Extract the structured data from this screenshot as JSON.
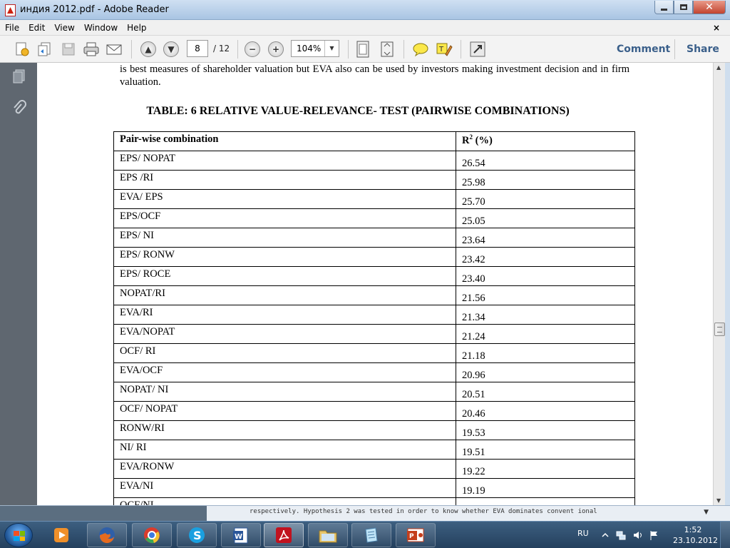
{
  "window": {
    "title": "индия 2012.pdf - Adobe Reader",
    "buttons": {
      "minimize": "minimize-icon",
      "maximize": "maximize-icon",
      "close": "close-icon"
    }
  },
  "menubar": {
    "items": [
      "File",
      "Edit",
      "View",
      "Window",
      "Help"
    ],
    "doc_close": "×"
  },
  "toolbar": {
    "page_current": "8",
    "page_total": "/ 12",
    "zoom": "104%",
    "comment_label": "Comment",
    "share_label": "Share"
  },
  "document": {
    "paragraph": "is best measures of shareholder valuation but EVA also can be used by investors making investment decision and in firm valuation.",
    "table_title": "TABLE: 6 RELATIVE VALUE-RELEVANCE- TEST (PAIRWISE COMBINATIONS)",
    "table_header": {
      "col1": "Pair-wise  combination",
      "col2_base": "R",
      "col2_sup": "2",
      "col2_rest": " (%)"
    },
    "rows": [
      {
        "pair": "EPS/ NOPAT",
        "r2": "26.54"
      },
      {
        "pair": "EPS /RI",
        "r2": "25.98"
      },
      {
        "pair": "EVA/ EPS",
        "r2": "25.70"
      },
      {
        "pair": "EPS/OCF",
        "r2": "25.05"
      },
      {
        "pair": "EPS/ NI",
        "r2": "23.64"
      },
      {
        "pair": "EPS/ RONW",
        "r2": "23.42"
      },
      {
        "pair": "EPS/ ROCE",
        "r2": "23.40"
      },
      {
        "pair": "NOPAT/RI",
        "r2": "21.56"
      },
      {
        "pair": "EVA/RI",
        "r2": "21.34"
      },
      {
        "pair": "EVA/NOPAT",
        "r2": "21.24"
      },
      {
        "pair": "OCF/ RI",
        "r2": "21.18"
      },
      {
        "pair": "EVA/OCF",
        "r2": "20.96"
      },
      {
        "pair": "NOPAT/ NI",
        "r2": "20.51"
      },
      {
        "pair": "OCF/ NOPAT",
        "r2": "20.46"
      },
      {
        "pair": "RONW/RI",
        "r2": "19.53"
      },
      {
        "pair": "NI/ RI",
        "r2": "19.51"
      },
      {
        "pair": "EVA/RONW",
        "r2": "19.22"
      },
      {
        "pair": "EVA/NI",
        "r2": "19.19"
      },
      {
        "pair": "OCF/NI",
        "r2": ""
      }
    ]
  },
  "background_window": {
    "text": "respectively. Hypothesis 2 was tested in order to know whether EVA dominates convent ional"
  },
  "taskbar": {
    "apps": [
      "windows-media-player-icon",
      "firefox-icon",
      "chrome-icon",
      "skype-icon",
      "word-icon",
      "adobe-reader-icon",
      "folder-icon",
      "notepad-icon",
      "powerpoint-icon"
    ],
    "language": "RU",
    "time": "1:52",
    "date": "23.10.2012"
  }
}
